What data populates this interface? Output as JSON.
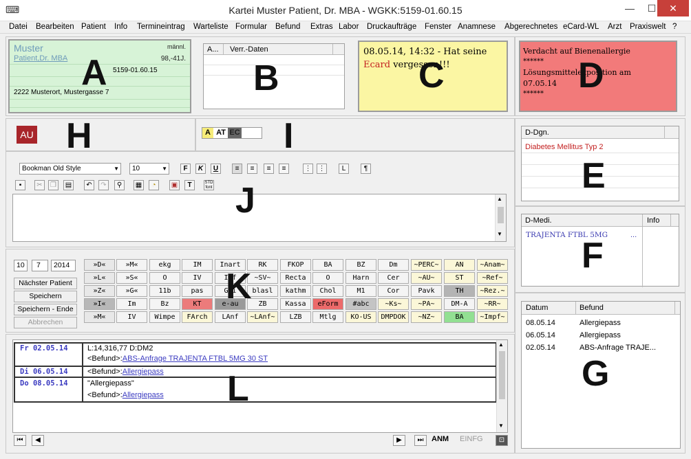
{
  "window": {
    "title": "Kartei Muster Patient, Dr. MBA - WGKK:5159-01.60.15",
    "minimize": "—",
    "maximize": "☐",
    "close": "✕"
  },
  "menu": [
    "Datei",
    "Bearbeiten",
    "Patient",
    "Info",
    "Termineintrag",
    "Warteliste",
    "Formular",
    "Befund",
    "Extras",
    "Labor",
    "Druckaufträge",
    "Fenster",
    "Anamnese",
    "Abgerechnetes",
    "eCard-WL",
    "Arzt",
    "Praxiswelt",
    "?"
  ],
  "labels": {
    "A": "A",
    "B": "B",
    "C": "C",
    "D": "D",
    "E": "E",
    "F": "F",
    "G": "G",
    "H": "H",
    "I": "I",
    "J": "J",
    "K": "K",
    "L": "L"
  },
  "patient": {
    "name": "Muster",
    "title": "Patient,Dr. MBA",
    "gender": "männl.",
    "age": "98,-41J.",
    "ssn": "5159-01.60.15",
    "address": "2222 Musterort, Mustergasse 7"
  },
  "verr": {
    "col_a": "A...",
    "col_b": "Verr.-Daten"
  },
  "note_yellow": {
    "line1": "08.05.14, 14:32 - Hat seine",
    "word_red": "Ecard",
    "rest": "vergessen!!!"
  },
  "note_red": {
    "l1": "Verdacht auf Bienenallergie",
    "l2": "******",
    "l3": "Lösungsmittelexposition am",
    "l4": "07.05.14",
    "l5": "******"
  },
  "au": "AU",
  "badge": {
    "a": "A",
    "at": "AT",
    "ec": "EC"
  },
  "editor": {
    "font": "Bookman Old Style",
    "size": "10",
    "bold": "F",
    "italic": "K",
    "underline": "U",
    "para": "¶",
    "std": "STD font"
  },
  "dgn": {
    "header": "D-Dgn.",
    "item": "Diabetes Mellitus Typ 2"
  },
  "medi": {
    "header": "D-Medi.",
    "info": "Info",
    "item": "TRAJENTA FTBL 5MG",
    "more": "..."
  },
  "befund": {
    "col_date": "Datum",
    "col_befund": "Befund",
    "rows": [
      {
        "date": "08.05.14",
        "text": "Allergiepass"
      },
      {
        "date": "06.05.14",
        "text": "Allergiepass"
      },
      {
        "date": "02.05.14",
        "text": "ABS-Anfrage TRAJE..."
      }
    ]
  },
  "date": {
    "d": "10",
    "m": "7",
    "y": "2014"
  },
  "actions": {
    "next": "Nächster Patient",
    "save": "Speichern",
    "save_end": "Speichern - Ende",
    "cancel": "Abbrechen"
  },
  "kbuttons": [
    [
      "»D«",
      "»M«",
      "ekg",
      "IM",
      "Inart",
      "RK",
      "FKOP",
      "BA",
      "BZ",
      "Dm",
      "~PERC~",
      "AN",
      "~Anam~"
    ],
    [
      "»L«",
      "»S«",
      "O",
      "IV",
      "Inf",
      "~SV~",
      "Recta",
      "O",
      "Harn",
      "Cer",
      "~AU~",
      "ST",
      "~Ref~"
    ],
    [
      "»Z«",
      "»G«",
      "11b",
      "pas",
      "Gri",
      "blasl",
      "kathm",
      "Chol",
      "M1",
      "Cor",
      "Pavk",
      "TH",
      "~Rez.~"
    ],
    [
      "»I«",
      "Im",
      "Bz",
      "KT",
      "e-au",
      "ZB",
      "Kassa",
      "eForm",
      "#abc",
      "~Ks~",
      "~PA~",
      "DM-A",
      "~RR~"
    ],
    [
      "»M«",
      "IV",
      "Wimpe",
      "FArch",
      "LAnf",
      "~LAnf~",
      "LZB",
      "Mtlg",
      "KO-US",
      "DMPDOK",
      "~NZ~",
      "BA",
      "~Impf~"
    ]
  ],
  "kcolors": [
    [
      "#e8e8e8",
      "#f4f4f4",
      "#f4f4f4",
      "#f4f4f4",
      "#f4f4f4",
      "#f4f4f4",
      "#f4f4f4",
      "#f4f4f4",
      "#f4f4f4",
      "#f4f4f4",
      "#fbf7d8",
      "#fbf7d8",
      "#fbf7d8"
    ],
    [
      "#e8e8e8",
      "#f4f4f4",
      "#f4f4f4",
      "#f4f4f4",
      "#f4f4f4",
      "#f4f4f4",
      "#f4f4f4",
      "#f4f4f4",
      "#f4f4f4",
      "#f4f4f4",
      "#fbf7d8",
      "#fbf7d8",
      "#fbf7d8"
    ],
    [
      "#e8e8e8",
      "#f4f4f4",
      "#f4f4f4",
      "#f4f4f4",
      "#f4f4f4",
      "#f4f4f4",
      "#f4f4f4",
      "#f4f4f4",
      "#f4f4f4",
      "#f4f4f4",
      "#f4f4f4",
      "#b4b4b4",
      "#fbf7d8"
    ],
    [
      "#b8b8b8",
      "#f4f4f4",
      "#f4f4f4",
      "#ec7b7b",
      "#9a9a9a",
      "#f4f4f4",
      "#f4f4f4",
      "#ec6a6a",
      "#c4c4c4",
      "#fbf7d8",
      "#fbf7d8",
      "#f4f4f4",
      "#fbf7d8"
    ],
    [
      "#e8e8e8",
      "#f4f4f4",
      "#f4f4f4",
      "#fbf7d8",
      "#f4f4f4",
      "#fbf7d8",
      "#f4f4f4",
      "#f4f4f4",
      "#fbf7d8",
      "#fbf7d8",
      "#fbf7d8",
      "#92e092",
      "#fbf7d8"
    ]
  ],
  "journal": [
    {
      "date": "Fr 02.05.14",
      "l1": "L:14,316,77 D:DM2",
      "tag": "<Befund>:",
      "link": "ABS-Anfrage TRAJENTA FTBL 5MG 30 ST"
    },
    {
      "date": "Di 06.05.14",
      "l1": "",
      "tag": "<Befund>:",
      "link": "Allergiepass"
    },
    {
      "date": "Do 08.05.14",
      "l1": "\"Allergiepass\"",
      "tag": "<Befund>:",
      "link": "Allergiepass"
    }
  ],
  "bottom": {
    "anm": "ANM",
    "einfg": "EINFG"
  }
}
